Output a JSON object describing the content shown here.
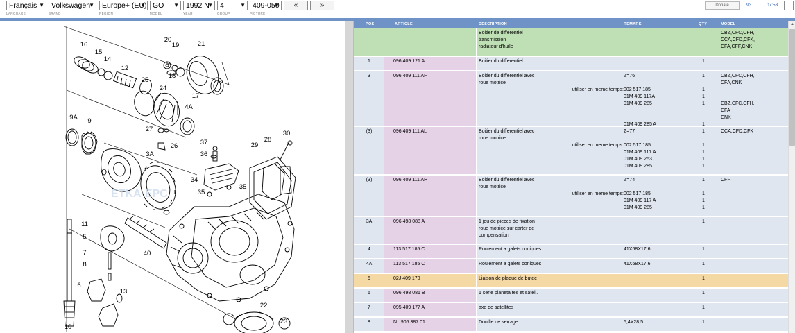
{
  "toolbar": {
    "language": "Français",
    "brand": "Volkswagen",
    "region": "Europe+ (EU)",
    "model": "GO",
    "year": "1992  N",
    "group": "4",
    "picture": "409-050",
    "prev_label": "«",
    "next_label": "»",
    "donate_label": "Donate",
    "counter": "93",
    "clock": "07:53"
  },
  "filter_labels": {
    "language": "LANGUAGE",
    "brand": "BRAND",
    "region": "REGION",
    "model": "MODEL",
    "year": "YEAR",
    "group": "GROUP",
    "picture": "PICTURE"
  },
  "icons": {
    "dropdown": "chevron-down-icon",
    "prev": "double-chevron-left-icon",
    "next": "double-chevron-right-icon",
    "fullscreen": "fullscreen-icon",
    "scroll_up": "scroll-up-icon"
  },
  "colors": {
    "header_blue": "#6f93c7",
    "row_blue": "#dfe6f0",
    "article_pink": "#e6d2e6",
    "highlight_orange": "#f5d9a5",
    "title_green": "#bfe0b4"
  },
  "diagram": {
    "labels": [
      "16",
      "15",
      "14",
      "12",
      "20",
      "19",
      "18",
      "21",
      "25",
      "24",
      "4A",
      "17",
      "9A",
      "9",
      "27",
      "26",
      "3A",
      "37",
      "36",
      "30",
      "28",
      "29",
      "34",
      "35",
      "35",
      "11",
      "5",
      "7",
      "8",
      "40",
      "6",
      "13",
      "22",
      "10",
      "23"
    ]
  },
  "table": {
    "headers": {
      "pos": "POS",
      "article": "ARTICLE",
      "description": "DESCRIPTION",
      "remark": "REMARK",
      "qty": "QTY",
      "model": "MODEL"
    },
    "rows": [
      {
        "pos": "",
        "article": "",
        "description": "Boitier de differentiel\ntransmission\nradiateur d'huile",
        "use": "",
        "remark": "",
        "qty": "",
        "model": "CBZ,CFC,CFH,\nCCA,CFD,CFK,\nCFA,CFF,CNK"
      },
      {
        "pos": "1",
        "article": "096 409 121 A",
        "description": "Boitier du differentiel",
        "use": "",
        "remark": "",
        "qty": "1",
        "model": ""
      },
      {
        "pos": "3",
        "article": "096 409 111 AF",
        "description": "Boitier du differentiel avec\nroue motrice",
        "use": "\n\nutiliser en meme temps:",
        "remark": "Z=76\n\n002 517 185\n01M 409 117A\n01M 409 285\n\n\n01M 409 285 A",
        "qty": "1\n\n1\n1\n1\n\n\n1",
        "model": "CBZ,CFC,CFH,\nCFA,CNK\n\n\nCBZ,CFC,CFH,\nCFA\nCNK"
      },
      {
        "pos": "(3)",
        "article": "096 409 111 AL",
        "description": "Boitier du differentiel avec\nroue motrice",
        "use": "\n\nutiliser en meme temps:",
        "remark": "Z=77\n\n002 517 185\n01M 409 117 A\n01M 409 253\n01M 409 285",
        "qty": "1\n\n1\n1\n1\n1",
        "model": "CCA,CFD,CFK"
      },
      {
        "pos": "(3)",
        "article": "096 409 111 AH",
        "description": "Boitier du differentiel avec\nroue motrice",
        "use": "\n\nutiliser en meme temps:",
        "remark": "Z=74\n\n002 517 185\n01M 409 117 A\n01M 409 285",
        "qty": "1\n\n1\n1\n1",
        "model": "CFF"
      },
      {
        "pos": "3A",
        "article": "096 498 088 A",
        "description": "1 jeu de pieces de fixation\nroue motrice sur carter de\ncompensation",
        "use": "",
        "remark": "",
        "qty": "1",
        "model": ""
      },
      {
        "pos": "4",
        "article": "113 517 185 C",
        "description": "Roulement a galets coniques",
        "use": "",
        "remark": "41X68X17,6",
        "qty": "1",
        "model": ""
      },
      {
        "pos": "4A",
        "article": "113 517 185 C",
        "description": "Roulement a galets coniques",
        "use": "",
        "remark": "41X68X17,6",
        "qty": "1",
        "model": ""
      },
      {
        "pos": "5",
        "article": "02J 409 170",
        "description": "Liaison de plaque de butee",
        "use": "",
        "remark": "",
        "qty": "1",
        "model": ""
      },
      {
        "pos": "6",
        "article": "096 498 081 B",
        "description": "1 serie planetaires et satell.",
        "use": "",
        "remark": "",
        "qty": "1",
        "model": ""
      },
      {
        "pos": "7",
        "article": "095 409 177 A",
        "description": "axe de satellites",
        "use": "",
        "remark": "",
        "qty": "1",
        "model": ""
      },
      {
        "pos": "8",
        "article": "N   905 387 01",
        "description": "Douille de serrage",
        "use": "",
        "remark": "5,4X28,5",
        "qty": "1",
        "model": ""
      }
    ]
  }
}
